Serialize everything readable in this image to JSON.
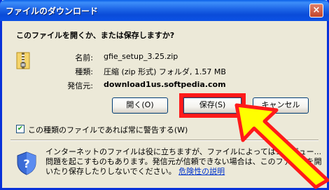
{
  "window": {
    "title": "ファイルのダウンロード",
    "close_label": "×"
  },
  "question": "このファイルを開くか、または保存しますか?",
  "file": {
    "name_label": "名前:",
    "name_value": "gfie_setup_3.25.zip",
    "type_label": "種類:",
    "type_value": "圧縮 (zip 形式) フォルダ, 1.57 MB",
    "source_label": "発信元:",
    "source_value": "download1us.softpedia.com"
  },
  "buttons": {
    "open": "開く(O)",
    "save": "保存(S)",
    "cancel": "キャンセル"
  },
  "checkbox": {
    "checked": true,
    "label": "この種類のファイルであれば常に警告する(W)"
  },
  "warning": {
    "text": "インターネットのファイルは役に立ちますが、ファイルによってはコンピュー... 問題を起こすものもあります。発信元が信頼できない場合は、このファイルを開いたり保存したりしないでください。",
    "link": "危険性の説明"
  },
  "colors": {
    "highlight": "#ff1a1a",
    "arrow_fill": "#ffff00"
  }
}
